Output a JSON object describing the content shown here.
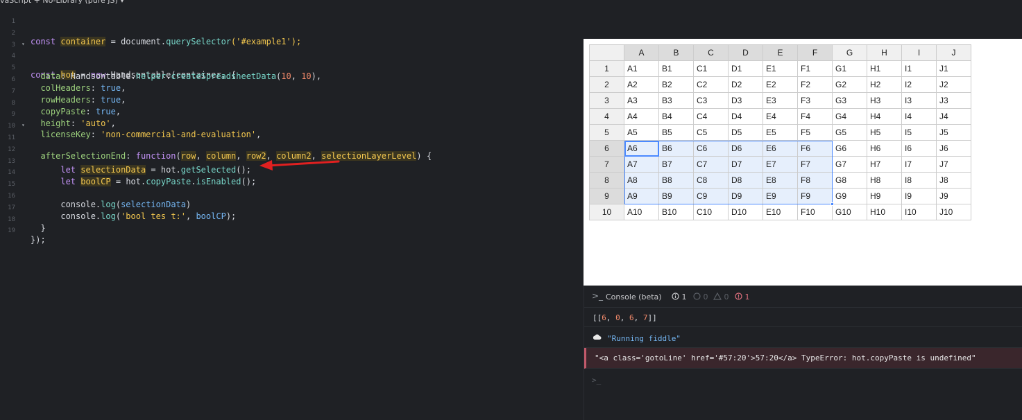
{
  "editor": {
    "tab_title": "vaScript + No-Library (pure JS) ▾",
    "lines": [
      {
        "n": "1"
      },
      {
        "n": "2"
      },
      {
        "n": "3"
      },
      {
        "n": "4"
      },
      {
        "n": "5"
      },
      {
        "n": "6"
      },
      {
        "n": "7"
      },
      {
        "n": "8"
      },
      {
        "n": "9"
      },
      {
        "n": "10"
      },
      {
        "n": "11"
      },
      {
        "n": "12"
      },
      {
        "n": "13"
      },
      {
        "n": "14"
      },
      {
        "n": "15"
      },
      {
        "n": "16"
      },
      {
        "n": "17"
      },
      {
        "n": "18"
      },
      {
        "n": "19"
      }
    ],
    "tokens": {
      "const": "const",
      "container": "container",
      "doc_qs": "= document.",
      "qs": "querySelector",
      "qs_arg": "('#example1');",
      "hot": "hot",
      "eq_new": "= ",
      "new": "new",
      "hs_ctor": " Handsontable(container, {",
      "data_key": "data",
      "data_val": ": Handsontable.",
      "helper": "helper",
      "dot": ".",
      "create": "createSpreadsheetData",
      "paren_open": "(",
      "ten_a": "10",
      "comma_sp": ", ",
      "ten_b": "10",
      "paren_close_comma": "),",
      "colHeaders": "colHeaders",
      "rowHeaders": "rowHeaders",
      "copyPaste": "copyPaste",
      "colon_sp": ": ",
      "true": "true",
      "comma": ",",
      "height": "height",
      "auto": "'auto'",
      "licenseKey": "licenseKey",
      "license_val": "'non-commercial-and-evaluation'",
      "afterSel": "afterSelectionEnd",
      "function": "function",
      "row": "row",
      "column": "column",
      "row2": "row2",
      "column2": "column2",
      "selLayer": "selectionLayerLevel",
      "fn_tail": ") {",
      "let": "let",
      "selectionData": "selectionData",
      "eq_hot": " = hot.",
      "getSelected": "getSelected",
      "call_end": "();",
      "boolCP": "boolCP",
      "copyPaste_prop": "copyPaste",
      "isEnabled": "isEnabled",
      "console_log": "console.",
      "log": "log",
      "close_paren": ")",
      "bool_str": "'bool tes t:'",
      "close_paren_semi": ");",
      "brace_close": "}",
      "end_close": "});"
    }
  },
  "sheet": {
    "col_headers": [
      "A",
      "B",
      "C",
      "D",
      "E",
      "F",
      "G",
      "H",
      "I",
      "J"
    ],
    "rows": [
      {
        "h": "1",
        "c": [
          "A1",
          "B1",
          "C1",
          "D1",
          "E1",
          "F1",
          "G1",
          "H1",
          "I1",
          "J1"
        ]
      },
      {
        "h": "2",
        "c": [
          "A2",
          "B2",
          "C2",
          "D2",
          "E2",
          "F2",
          "G2",
          "H2",
          "I2",
          "J2"
        ]
      },
      {
        "h": "3",
        "c": [
          "A3",
          "B3",
          "C3",
          "D3",
          "E3",
          "F3",
          "G3",
          "H3",
          "I3",
          "J3"
        ]
      },
      {
        "h": "4",
        "c": [
          "A4",
          "B4",
          "C4",
          "D4",
          "E4",
          "F4",
          "G4",
          "H4",
          "I4",
          "J4"
        ]
      },
      {
        "h": "5",
        "c": [
          "A5",
          "B5",
          "C5",
          "D5",
          "E5",
          "F5",
          "G5",
          "H5",
          "I5",
          "J5"
        ]
      },
      {
        "h": "6",
        "c": [
          "A6",
          "B6",
          "C6",
          "D6",
          "E6",
          "F6",
          "G6",
          "H6",
          "I6",
          "J6"
        ]
      },
      {
        "h": "7",
        "c": [
          "A7",
          "B7",
          "C7",
          "D7",
          "E7",
          "F7",
          "G7",
          "H7",
          "I7",
          "J7"
        ]
      },
      {
        "h": "8",
        "c": [
          "A8",
          "B8",
          "C8",
          "D8",
          "E8",
          "F8",
          "G8",
          "H8",
          "I8",
          "J8"
        ]
      },
      {
        "h": "9",
        "c": [
          "A9",
          "B9",
          "C9",
          "D9",
          "E9",
          "F9",
          "G9",
          "H9",
          "I9",
          "J9"
        ]
      },
      {
        "h": "10",
        "c": [
          "A10",
          "B10",
          "C10",
          "D10",
          "E10",
          "F10",
          "G10",
          "H10",
          "I10",
          "J10"
        ]
      }
    ],
    "selection": {
      "from_row": 6,
      "to_row": 9,
      "from_col": 1,
      "to_col": 6
    }
  },
  "console": {
    "title": "Console (beta)",
    "count_info": "1",
    "count_log": "0",
    "count_warn": "0",
    "count_error": "1",
    "output_array_open": "[[",
    "output_v1": "6",
    "output_v2": "0",
    "output_v3": "6",
    "output_v4": "7",
    "output_sep": ", ",
    "output_array_close": "]]",
    "running": "\"Running fiddle\"",
    "error": "\"<a class='gotoLine' href='#57:20'>57:20</a> TypeError: hot.copyPaste is undefined\"",
    "prompt": ">_"
  },
  "colors": {
    "selection_border": "#4b89ff",
    "selection_fill": "#e6effc",
    "arrow": "#e02020",
    "error_bg": "#3a262c"
  }
}
